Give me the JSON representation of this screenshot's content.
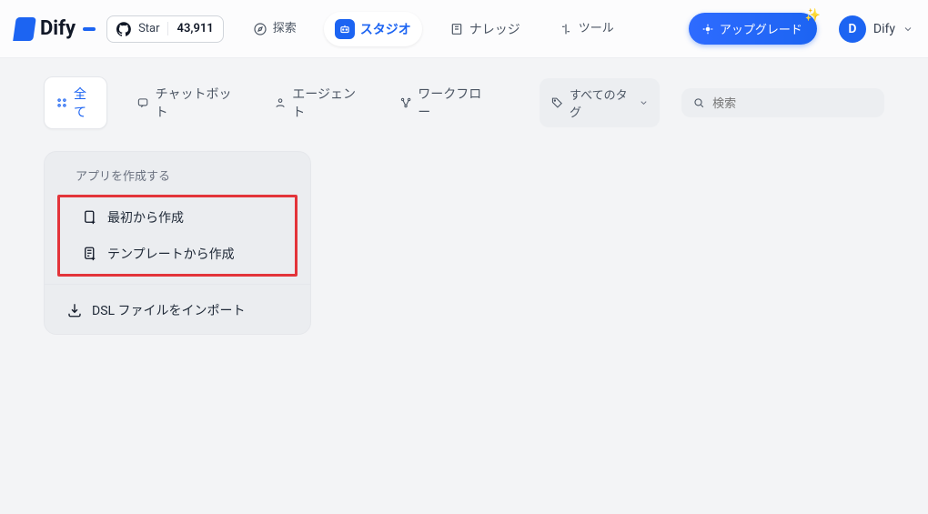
{
  "brand": {
    "name": "Dify"
  },
  "github": {
    "label": "Star",
    "count": "43,911"
  },
  "nav": {
    "explore": "探索",
    "studio": "スタジオ",
    "knowledge": "ナレッジ",
    "tools": "ツール"
  },
  "upgrade": {
    "label": "アップグレード"
  },
  "user": {
    "initial": "D",
    "name": "Dify"
  },
  "tabs": {
    "all": "全て",
    "chatbot": "チャットボット",
    "agent": "エージェント",
    "workflow": "ワークフロー"
  },
  "tag_filter": {
    "label": "すべてのタグ"
  },
  "search": {
    "placeholder": "検索"
  },
  "create": {
    "title": "アプリを作成する",
    "from_blank": "最初から作成",
    "from_template": "テンプレートから作成",
    "import_dsl": "DSL ファイルをインポート"
  }
}
